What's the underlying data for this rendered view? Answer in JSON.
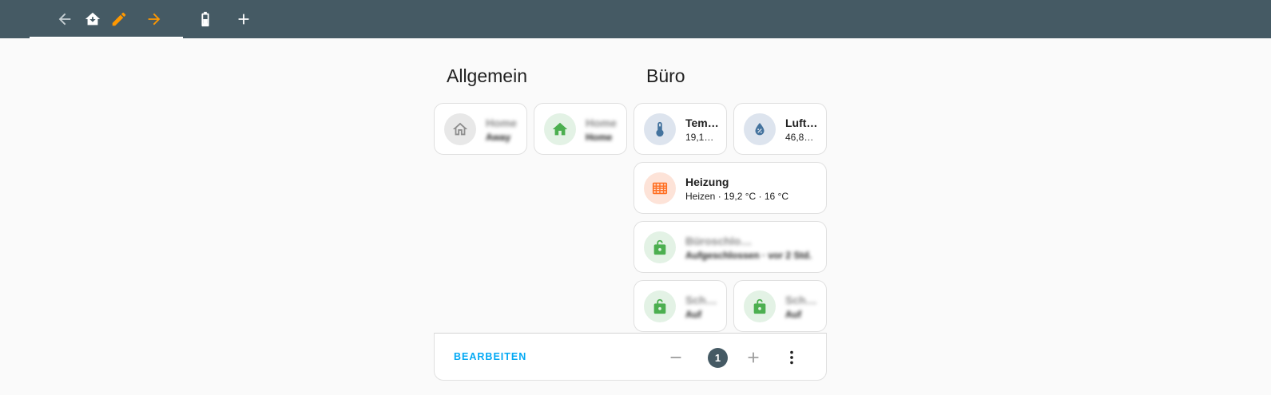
{
  "toolbar": {
    "icons": [
      "arrow-left-icon",
      "home-import-icon",
      "pencil-icon",
      "arrow-right-icon",
      "battery-icon",
      "plus-icon"
    ],
    "colors": {
      "background": "#455a64",
      "accent": "#ff9800"
    }
  },
  "sections": [
    {
      "title": "Allgemein"
    },
    {
      "title": "Büro"
    }
  ],
  "allgemein": {
    "card1": {
      "name": "Home",
      "state": "Away",
      "icon": "home-outline-icon"
    },
    "card2": {
      "name": "Home",
      "state": "Home",
      "icon": "home-icon"
    }
  },
  "buero": {
    "temperature": {
      "name": "Tem…",
      "state": "19,1…",
      "icon": "thermometer-icon"
    },
    "humidity": {
      "name": "Luft…",
      "state": "46,8…",
      "icon": "water-percent-icon"
    },
    "heating": {
      "name": "Heizung",
      "state": "Heizen · 19,2 °C · 16 °C",
      "icon": "radiator-icon"
    },
    "lock_wide": {
      "name": "Büroschloss Tür",
      "state": "Aufgeschlossen · vor 2 Std.",
      "icon": "lock-open-icon"
    },
    "lock_left": {
      "name": "Schloss",
      "state": "Auf",
      "icon": "lock-open-icon"
    },
    "lock_right": {
      "name": "Schloss",
      "state": "Auf",
      "icon": "lock-open-icon"
    }
  },
  "footer": {
    "edit_label": "BEARBEITEN",
    "page": "1"
  }
}
